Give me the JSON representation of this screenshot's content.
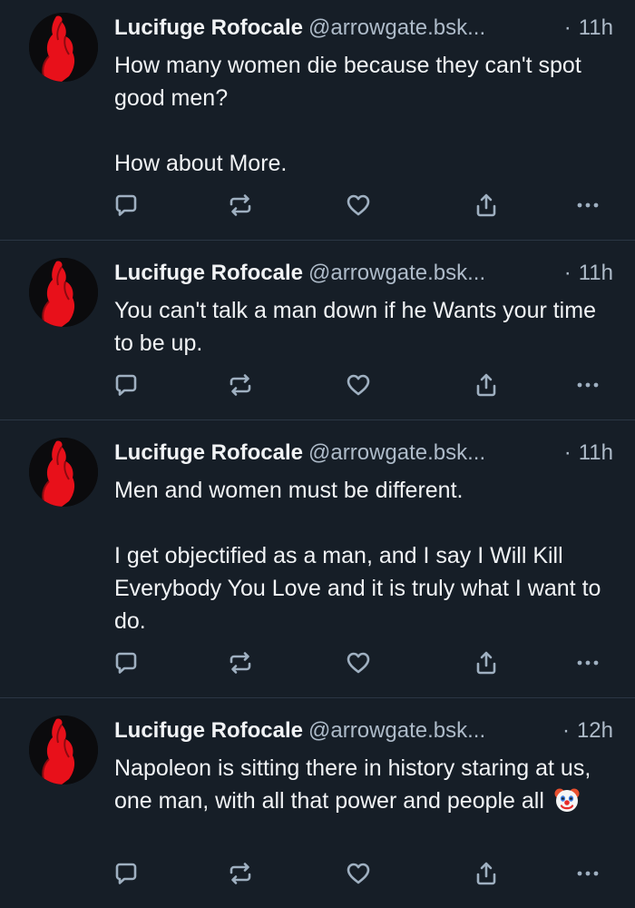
{
  "posts": [
    {
      "author": "Lucifuge Rofocale",
      "handle": "@arrowgate.bsk...",
      "time": "11h",
      "paragraphs": [
        "How many women die because they can't spot good men?",
        "How about More."
      ]
    },
    {
      "author": "Lucifuge Rofocale",
      "handle": "@arrowgate.bsk...",
      "time": "11h",
      "paragraphs": [
        "You can't talk a man down if he Wants your time to be up."
      ]
    },
    {
      "author": "Lucifuge Rofocale",
      "handle": "@arrowgate.bsk...",
      "time": "11h",
      "paragraphs": [
        "Men and women must be different.",
        "I get objectified as a man, and I say I Will Kill Everybody You Love and it is truly what I want to do."
      ]
    },
    {
      "author": "Lucifuge Rofocale",
      "handle": "@arrowgate.bsk...",
      "time": "12h",
      "paragraphs": [
        "Napoleon is sitting there in history staring at us, one man, with all that power and people all"
      ],
      "trailing_emoji": "clown-face-icon"
    }
  ],
  "time_separator": "·",
  "actions": [
    "reply-icon",
    "repost-icon",
    "like-icon",
    "share-icon",
    "more-options-icon"
  ],
  "colors": {
    "background": "#161e27",
    "text": "#f1f3f5",
    "muted": "#aebbc9",
    "icon": "#9fb0c1",
    "divider": "#2b3644",
    "avatar_figure": "#e8101a"
  }
}
